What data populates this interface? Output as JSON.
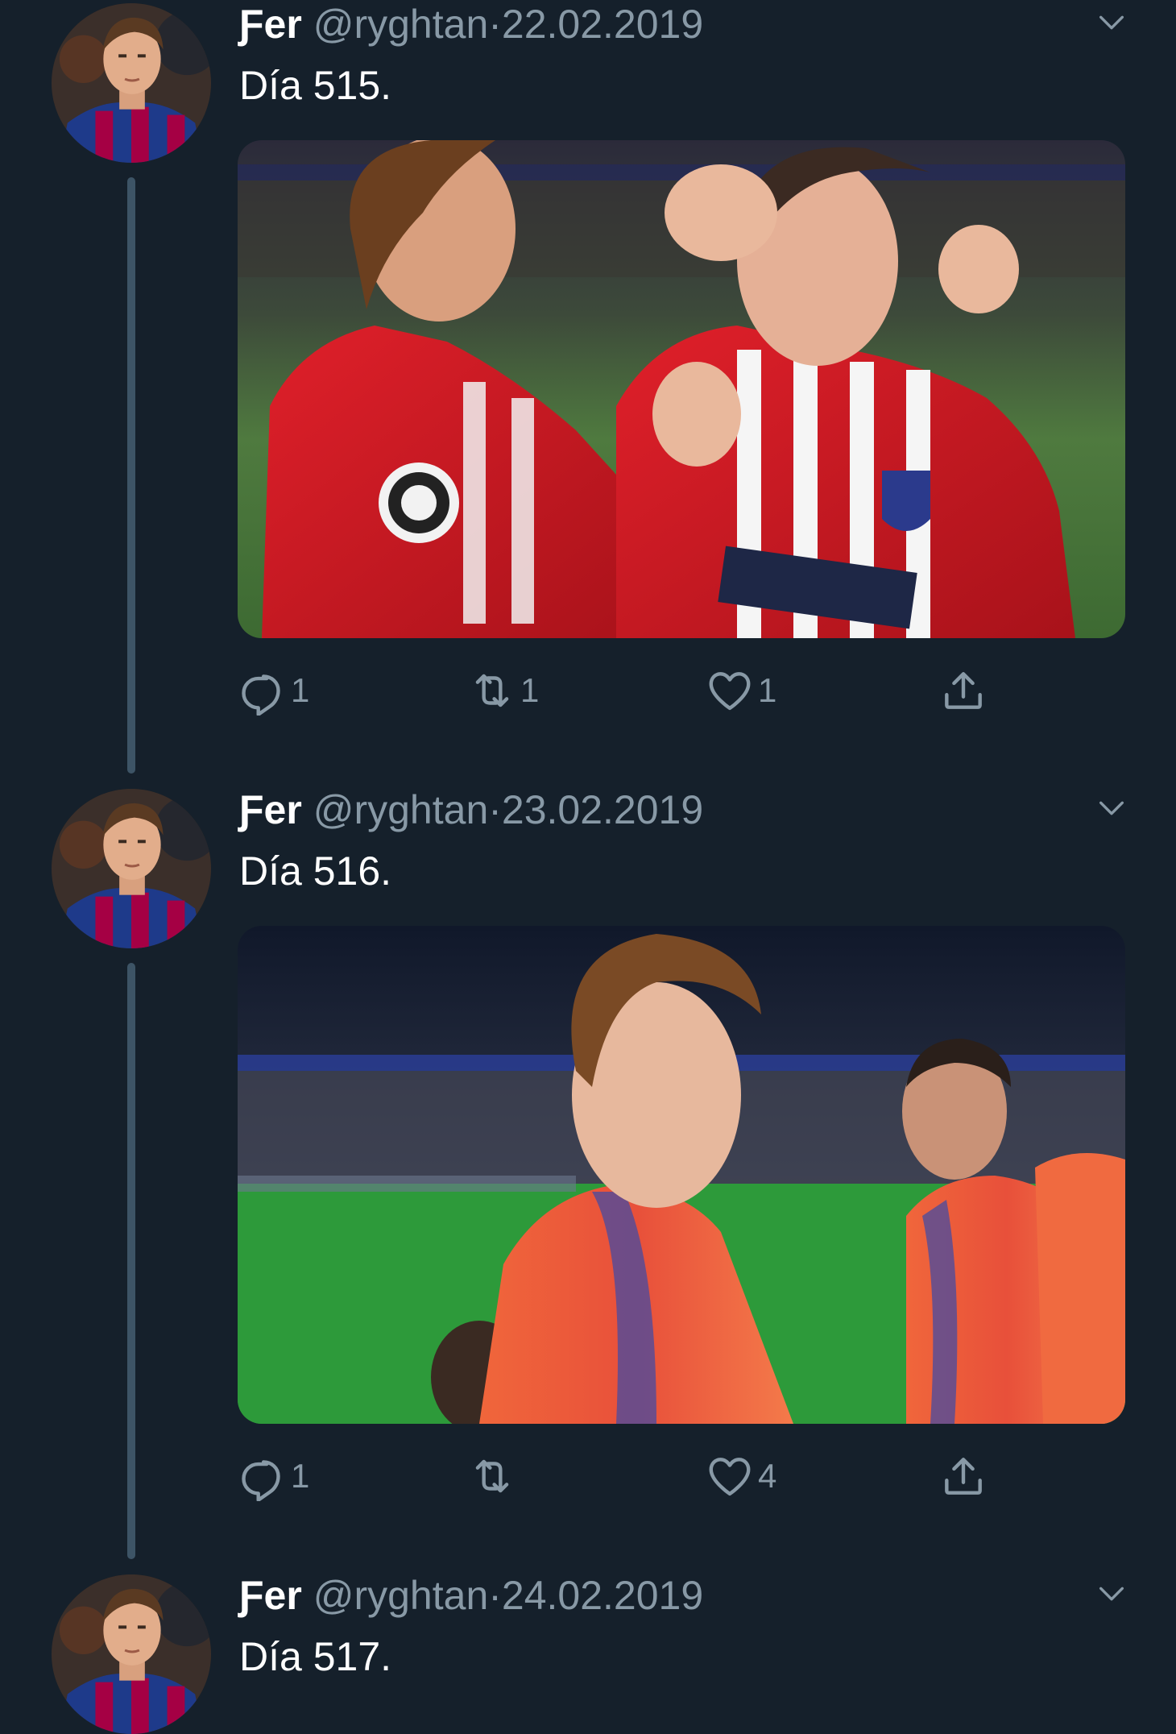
{
  "tweets": [
    {
      "name": "Ƒer",
      "handle": "@ryghtan",
      "separator": "·",
      "date": "22.02.2019",
      "text": "Día 515.",
      "replies": "1",
      "retweets": "1",
      "likes": "1"
    },
    {
      "name": "Ƒer",
      "handle": "@ryghtan",
      "separator": "·",
      "date": "23.02.2019",
      "text": "Día 516.",
      "replies": "1",
      "retweets": "",
      "likes": "4"
    },
    {
      "name": "Ƒer",
      "handle": "@ryghtan",
      "separator": "·",
      "date": "24.02.2019",
      "text": "Día 517."
    }
  ],
  "icons": {
    "reply": "reply-icon",
    "retweet": "retweet-icon",
    "like": "heart-icon",
    "share": "share-icon",
    "caret": "chevron-down-icon"
  },
  "colors": {
    "background": "#15202b",
    "secondary_text": "#8899a6",
    "thread_line": "#3d5466"
  }
}
